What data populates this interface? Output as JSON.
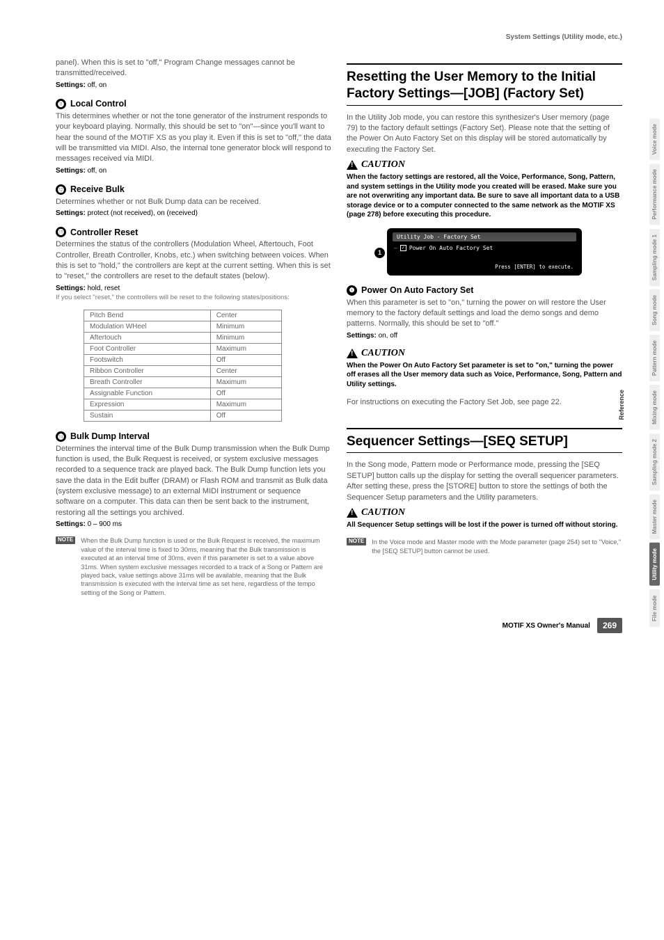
{
  "header": {
    "chapter": "System Settings (Utility mode, etc.)"
  },
  "left": {
    "intro_para": "panel). When this is set to \"off,\" Program Change messages cannot be transmitted/received.",
    "intro_settings": "off, on",
    "s11": {
      "num": "⓫",
      "title": "Local Control",
      "para": "This determines whether or not the tone generator of the instrument responds to your keyboard playing. Normally, this should be set to \"on\"—since you'll want to hear the sound of the MOTIF XS as you play it. Even if this is set to \"off,\" the data will be transmitted via MIDI. Also, the internal tone generator block will respond to messages received via MIDI.",
      "settings": "off, on"
    },
    "s12": {
      "num": "⓬",
      "title": "Receive Bulk",
      "para": "Determines whether or not Bulk Dump data can be received.",
      "settings": "protect (not received), on (received)"
    },
    "s13": {
      "num": "⓭",
      "title": "Controller Reset",
      "para": "Determines the status of the controllers (Modulation Wheel, Aftertouch, Foot Controller, Breath Controller, Knobs, etc.) when switching between voices. When this is set to \"hold,\" the controllers are kept at the current setting. When this is set to \"reset,\" the controllers are reset to the default states (below).",
      "settings": "hold, reset",
      "note": "If you select \"reset,\" the controllers will be reset to the following states/positions:",
      "table": [
        [
          "Pitch Bend",
          "Center"
        ],
        [
          "Modulation WHeel",
          "Minimum"
        ],
        [
          "Aftertouch",
          "Minimum"
        ],
        [
          "Foot Controller",
          "Maximum"
        ],
        [
          "Footswitch",
          "Off"
        ],
        [
          "Ribbon Controller",
          "Center"
        ],
        [
          "Breath Controller",
          "Maximum"
        ],
        [
          "Assignable Function",
          "Off"
        ],
        [
          "Expression",
          "Maximum"
        ],
        [
          "Sustain",
          "Off"
        ]
      ]
    },
    "s14": {
      "num": "⓮",
      "title": "Bulk Dump Interval",
      "para": "Determines the interval time of the Bulk Dump transmission when the Bulk Dump function is used, the Bulk Request is received, or system exclusive messages recorded to a sequence track are played back. The Bulk Dump function lets you save the data in the Edit buffer (DRAM) or Flash ROM and transmit as Bulk data (system exclusive message) to an external MIDI instrument or sequence software on a computer. This data can then be sent back to the instrument, restoring all the settings you archived.",
      "settings": "0 – 900 ms",
      "dnote": "When the Bulk Dump function is used or the Bulk Request is received, the maximum value of the interval time is fixed to 30ms, meaning that the Bulk transmission is executed at an interval time of 30ms, even if this parameter is set to a value above 31ms. When system exclusive messages recorded to a track of a Song or Pattern are played back, value settings above 31ms will be available, meaning that the Bulk transmission is executed with the interval time as set here, regardless of the tempo setting of the Song or Pattern."
    }
  },
  "right": {
    "h2a": "Resetting the User Memory to the Initial Factory Settings—[JOB] (Factory Set)",
    "para1": "In the Utility Job mode, you can restore this synthesizer's User memory (page 79) to the factory default settings (Factory Set). Please note that the setting of the Power On Auto Factory Set on this display will be stored automatically by executing the Factory Set.",
    "caution_label": "CAUTION",
    "caution1": "When the factory settings are restored, all the Voice, Performance, Song, Pattern, and system settings in the Utility mode you created will be erased. Make sure you are not overwriting any important data. Be sure to save all important data to a USB storage device or to a computer connected to the same network as the MOTIF XS (page 278) before executing this procedure.",
    "screen": {
      "title": "Utility Job - Factory Set",
      "row": "Power On Auto Factory Set",
      "footer": "Press [ENTER] to execute.",
      "marker": "1"
    },
    "s1": {
      "num": "❶",
      "title": "Power On Auto Factory Set",
      "para": "When this parameter is set to \"on,\" turning the power on will restore the User memory to the factory default settings and load the demo songs and demo patterns. Normally, this should be set to \"off.\"",
      "settings": "on, off"
    },
    "caution2": "When the Power On Auto Factory Set parameter is set to \"on,\" turning the power off erases all the User memory data such as Voice, Performance, Song, Pattern and Utility settings.",
    "para2": "For instructions on executing the Factory Set Job, see page 22.",
    "h2b": "Sequencer Settings—[SEQ SETUP]",
    "para3": "In the Song mode, Pattern mode or Performance mode, pressing the [SEQ SETUP] button calls up the display for setting the overall sequencer parameters. After setting these, press the [STORE] button to store the settings of both the Sequencer Setup parameters and the Utility parameters.",
    "caution3": "All Sequencer Setup settings will be lost if the power is turned off without storing.",
    "dnote": "In the Voice mode and Master mode with the Mode parameter (page 254) set to \"Voice,\" the [SEQ SETUP] button cannot be used."
  },
  "tabs": [
    "Voice mode",
    "Performance mode",
    "Sampling mode 1",
    "Song mode",
    "Pattern mode",
    "Mixing mode",
    "Sampling mode 2",
    "Master mode",
    "Utility mode",
    "File mode"
  ],
  "tabs_active_index": 8,
  "reference_label": "Reference",
  "footer": {
    "manual": "MOTIF XS Owner's Manual",
    "page": "269"
  },
  "dnote_icon": "NOTE"
}
